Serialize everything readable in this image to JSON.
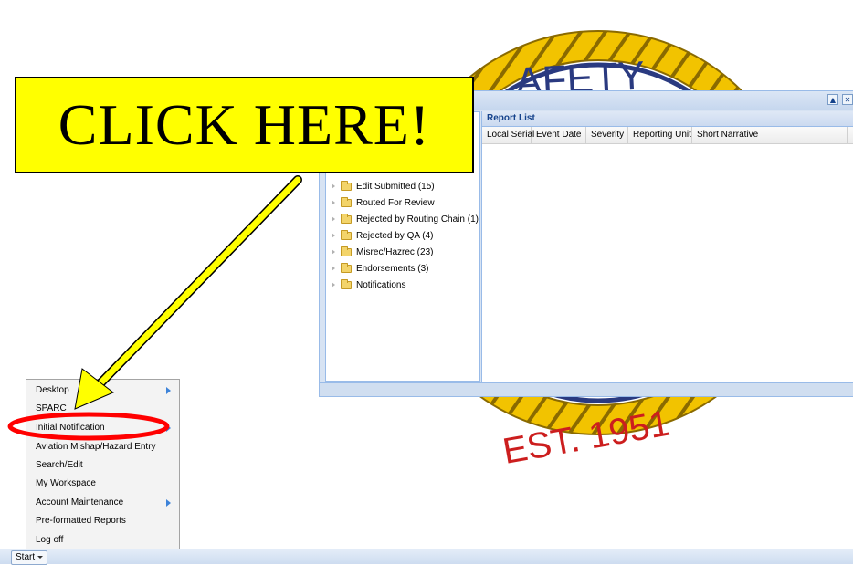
{
  "seal": {
    "top_text": "AFETY",
    "bottom_text": "EST. 1951",
    "colors": {
      "rope": "#f2c300",
      "navy": "#2a3a80",
      "rope_outline": "#8a6a00"
    }
  },
  "window": {
    "tools": [
      "restore-icon",
      "close-icon"
    ],
    "tree": [
      {
        "label": "Edit Submitted (15)"
      },
      {
        "label": "Routed For Review"
      },
      {
        "label": "Rejected by Routing Chain (1)"
      },
      {
        "label": "Rejected by QA (4)"
      },
      {
        "label": "Misrec/Hazrec (23)"
      },
      {
        "label": "Endorsements (3)"
      },
      {
        "label": "Notifications"
      }
    ],
    "list_title": "Report List",
    "columns": [
      "Local Serial",
      "Event Date",
      "Severity",
      "Reporting Unit",
      "Short Narrative"
    ]
  },
  "start_menu": {
    "items": [
      {
        "label": "Desktop",
        "submenu": true
      },
      {
        "label": "SPARC",
        "submenu": false
      },
      {
        "label": "Initial Notification",
        "submenu": true
      },
      {
        "label": "Aviation Mishap/Hazard Entry",
        "submenu": false
      },
      {
        "label": "Search/Edit",
        "submenu": false
      },
      {
        "label": "My Workspace",
        "submenu": false
      },
      {
        "label": "Account Maintenance",
        "submenu": true
      },
      {
        "label": "Pre-formatted Reports",
        "submenu": false
      },
      {
        "label": "Log off",
        "submenu": false
      }
    ]
  },
  "taskbar": {
    "start_label": "Start"
  },
  "callout": {
    "text": "CLICK HERE!",
    "colors": {
      "fill": "#ffff00",
      "arrow": "#ffff00",
      "highlight_ring": "#ff0000"
    }
  }
}
